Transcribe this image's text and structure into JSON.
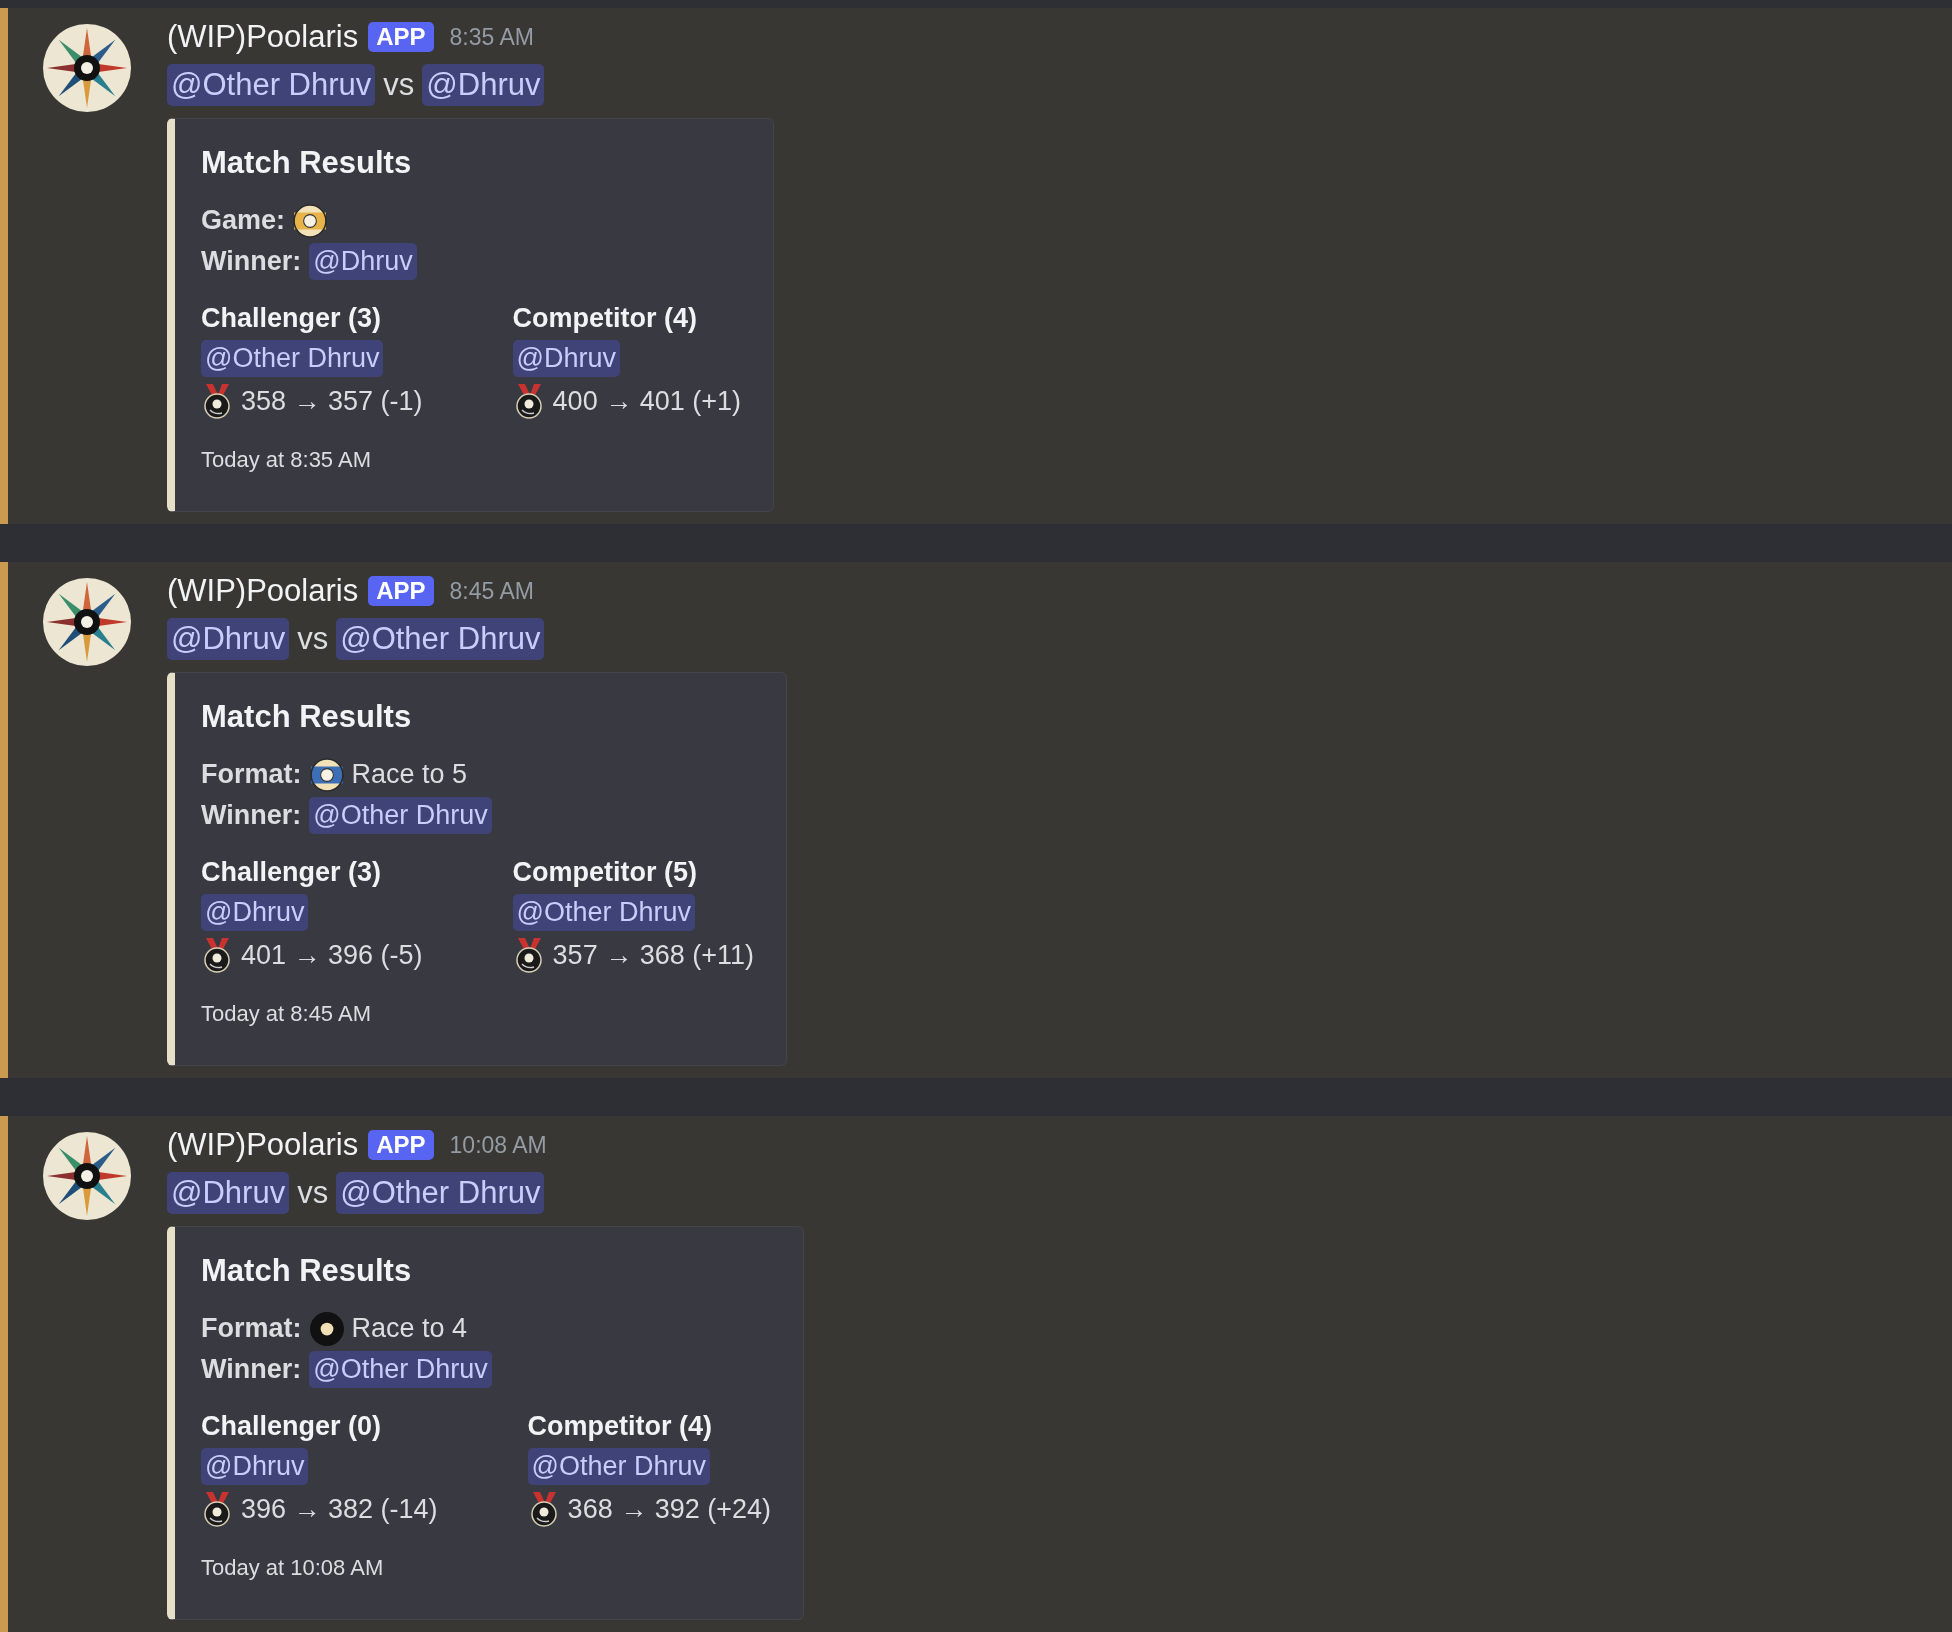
{
  "messages": [
    {
      "author": "(WIP)Poolaris",
      "badge": "APP",
      "time": "8:35 AM",
      "highlighted": true,
      "content": [
        {
          "kind": "mention",
          "text": "@Other Dhruv"
        },
        {
          "kind": "text",
          "text": "vs"
        },
        {
          "kind": "mention",
          "text": "@Dhruv"
        }
      ],
      "embed": {
        "title": "Match Results",
        "fields": [
          {
            "label": "Game:",
            "kind": "nineball"
          },
          {
            "label": "Winner:",
            "mention": "@Dhruv"
          }
        ],
        "columns": [
          {
            "heading": "Challenger (3)",
            "mention": "@Other Dhruv",
            "rating": "358 → 357 (-1)"
          },
          {
            "heading": "Competitor (4)",
            "mention": "@Dhruv",
            "rating": "400 → 401 (+1)"
          }
        ],
        "footer": "Today at 8:35 AM"
      }
    },
    {
      "author": "(WIP)Poolaris",
      "badge": "APP",
      "time": "8:45 AM",
      "highlighted": true,
      "content": [
        {
          "kind": "mention",
          "text": "@Dhruv"
        },
        {
          "kind": "text",
          "text": "vs"
        },
        {
          "kind": "mention",
          "text": "@Other Dhruv"
        }
      ],
      "embed": {
        "title": "Match Results",
        "fields": [
          {
            "label": "Format:",
            "kind": "tenball",
            "value": "Race to 5"
          },
          {
            "label": "Winner:",
            "mention": "@Other Dhruv"
          }
        ],
        "columns": [
          {
            "heading": "Challenger (3)",
            "mention": "@Dhruv",
            "rating": "401 → 396 (-5)"
          },
          {
            "heading": "Competitor (5)",
            "mention": "@Other Dhruv",
            "rating": "357 → 368 (+11)"
          }
        ],
        "footer": "Today at 8:45 AM"
      }
    },
    {
      "author": "(WIP)Poolaris",
      "badge": "APP",
      "time": "10:08 AM",
      "highlighted": true,
      "content": [
        {
          "kind": "mention",
          "text": "@Dhruv"
        },
        {
          "kind": "text",
          "text": "vs"
        },
        {
          "kind": "mention",
          "text": "@Other Dhruv"
        }
      ],
      "embed": {
        "title": "Match Results",
        "fields": [
          {
            "label": "Format:",
            "kind": "eightball",
            "value": "Race to 4"
          },
          {
            "label": "Winner:",
            "mention": "@Other Dhruv"
          }
        ],
        "columns": [
          {
            "heading": "Challenger (0)",
            "mention": "@Dhruv",
            "rating": "396 → 382 (-14)"
          },
          {
            "heading": "Competitor (4)",
            "mention": "@Other Dhruv",
            "rating": "368 → 392 (+24)"
          }
        ],
        "footer": "Today at 10:08 AM"
      }
    }
  ]
}
